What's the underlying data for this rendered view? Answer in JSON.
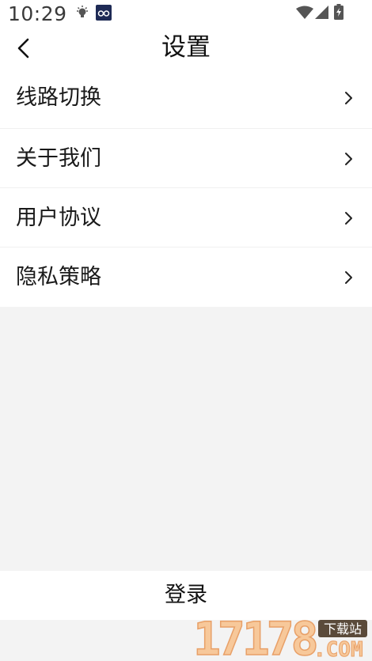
{
  "status_bar": {
    "time": "10:29"
  },
  "header": {
    "title": "设置"
  },
  "menu": {
    "items": [
      {
        "label": "线路切换"
      },
      {
        "label": "关于我们"
      },
      {
        "label": "用户协议"
      },
      {
        "label": "隐私策略"
      }
    ]
  },
  "footer": {
    "login_label": "登录"
  },
  "watermark": {
    "digits": "17178",
    "badge": "下载站",
    "domain": ".COM"
  },
  "colors": {
    "background": "#f3f3f3",
    "surface": "#ffffff",
    "text": "#111111",
    "watermark_orange": "#f5b57c"
  }
}
